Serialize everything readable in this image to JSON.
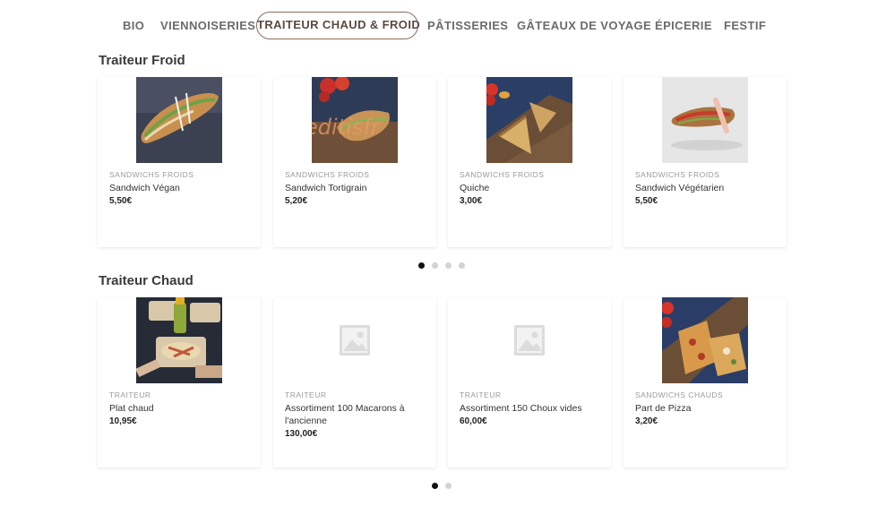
{
  "nav": {
    "items": [
      {
        "label": "BIO",
        "active": false
      },
      {
        "label": "VIENNOISERIES",
        "active": false
      },
      {
        "label": "TRAITEUR CHAUD & FROID",
        "active": true
      },
      {
        "label": "PÂTISSERIES",
        "active": false
      },
      {
        "label": "GÂTEAUX DE VOYAGE",
        "active": false
      },
      {
        "label": "ÉPICERIE",
        "active": false
      },
      {
        "label": "FESTIF",
        "active": false
      }
    ]
  },
  "sections": [
    {
      "title": "Traiteur Froid",
      "products": [
        {
          "category": "SANDWICHS FROIDS",
          "name": "Sandwich Végan",
          "price": "5,50€",
          "image": "sandwich-photo"
        },
        {
          "category": "SANDWICHS FROIDS",
          "name": "Sandwich Tortigrain",
          "price": "5,20€",
          "image": "sandwich-tomato-photo"
        },
        {
          "category": "SANDWICHS FROIDS",
          "name": "Quiche",
          "price": "3,00€",
          "image": "quiche-photo"
        },
        {
          "category": "SANDWICHS FROIDS",
          "name": "Sandwich Végétarien",
          "price": "5,50€",
          "image": "sandwich-light-photo"
        }
      ],
      "pager": {
        "count": 4,
        "active": 0
      }
    },
    {
      "title": "Traiteur Chaud",
      "products": [
        {
          "category": "TRAITEUR",
          "name": "Plat chaud",
          "price": "10,95€",
          "image": "hot-meal-photo"
        },
        {
          "category": "TRAITEUR",
          "name": "Assortiment 100 Macarons à l'ancienne",
          "price": "130,00€",
          "image": "placeholder-icon"
        },
        {
          "category": "TRAITEUR",
          "name": "Assortiment 150 Choux vides",
          "price": "60,00€",
          "image": "placeholder-icon"
        },
        {
          "category": "SANDWICHS CHAUDS",
          "name": "Part de Pizza",
          "price": "3,20€",
          "image": "pizza-photo"
        }
      ],
      "pager": {
        "count": 2,
        "active": 0
      }
    }
  ]
}
